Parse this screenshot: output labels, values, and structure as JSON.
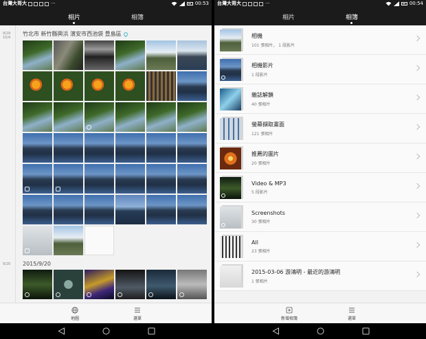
{
  "left": {
    "status": {
      "carrier": "台灣大哥大",
      "extra": "···",
      "time": "00:53"
    },
    "tabs": [
      {
        "label": "相片",
        "active": true
      },
      {
        "label": "相簿",
        "active": false
      }
    ],
    "groups": [
      {
        "date_top": "9/29",
        "date_bottom": "10/4",
        "location": "竹北市 新竹縣興浜 濱安市西池袋 豊島區"
      },
      {
        "date_top": "9/20",
        "date_bottom": "",
        "location": "2015/9/20"
      }
    ],
    "bottom": {
      "map_label": "地圖",
      "menu_label": "選單"
    }
  },
  "right": {
    "status": {
      "carrier": "台灣大哥大",
      "extra": "···",
      "time": "00:54"
    },
    "tabs": [
      {
        "label": "相片",
        "active": false
      },
      {
        "label": "相簿",
        "active": true
      }
    ],
    "albums": [
      {
        "name": "相機",
        "count": "101 張相片， 1 段影片"
      },
      {
        "name": "相機影片",
        "count": "1 段影片"
      },
      {
        "name": "雜誌解鎖",
        "count": "40 張相片"
      },
      {
        "name": "螢幕擷取畫面",
        "count": "121 張相片"
      },
      {
        "name": "推薦的圖片",
        "count": "20 張相片"
      },
      {
        "name": "Video & MP3",
        "count": "5 段影片"
      },
      {
        "name": "Screenshots",
        "count": "30 張相片"
      },
      {
        "name": "All",
        "count": "23 張相片"
      },
      {
        "name": "2015-03-06 游鴻明 - 最近的游鴻明",
        "count": "1 張相片"
      }
    ],
    "bottom": {
      "new_album_label": "新增相簿",
      "menu_label": "選單"
    }
  },
  "icons": [
    "location-pin-icon",
    "globe-icon",
    "menu-icon",
    "add-album-icon",
    "back-icon",
    "home-icon",
    "recents-icon",
    "chevron-right-icon",
    "video-badge-icon",
    "wifi-icon",
    "signal-icon",
    "battery-icon"
  ]
}
